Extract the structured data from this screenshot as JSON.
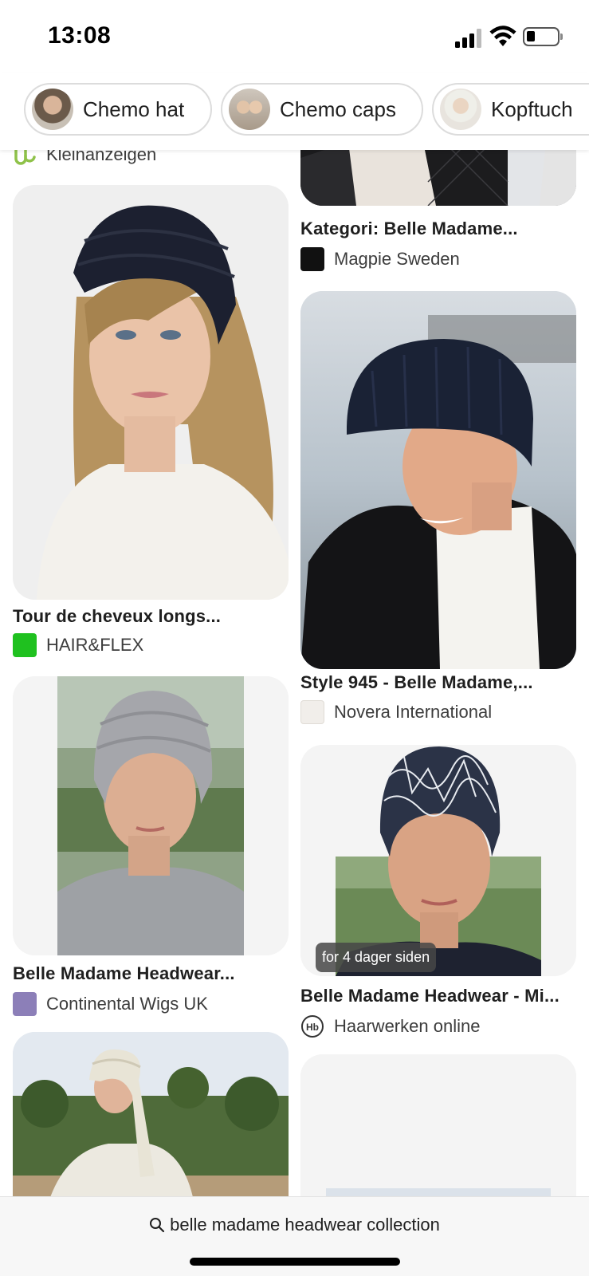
{
  "status_bar": {
    "time": "13:08"
  },
  "chips": [
    {
      "label": "Chemo hat"
    },
    {
      "label": "Chemo caps"
    },
    {
      "label": "Kopftuch"
    }
  ],
  "results": {
    "partial_top_source": "Kleinanzeigen",
    "left": [
      {
        "caption": "Tour de cheveux longs...",
        "source": "HAIR&FLEX"
      },
      {
        "caption": "Belle Madame Headwear...",
        "source": "Continental Wigs UK"
      }
    ],
    "right": [
      {
        "caption": "Kategori: Belle Madame...",
        "source": "Magpie Sweden"
      },
      {
        "caption": "Style 945 - Belle Madame,...",
        "source": "Novera International"
      },
      {
        "caption": "Belle Madame Headwear - Mi...",
        "source": "Haarwerken online",
        "badge": "for 4 dager siden"
      }
    ]
  },
  "search": {
    "query": "belle madame headwear collection"
  },
  "colors": {
    "hairflex_favicon": "#1fc11f",
    "kleinanzeigen_logo": "#8fc24a",
    "chip_border": "#dcdcdc"
  }
}
